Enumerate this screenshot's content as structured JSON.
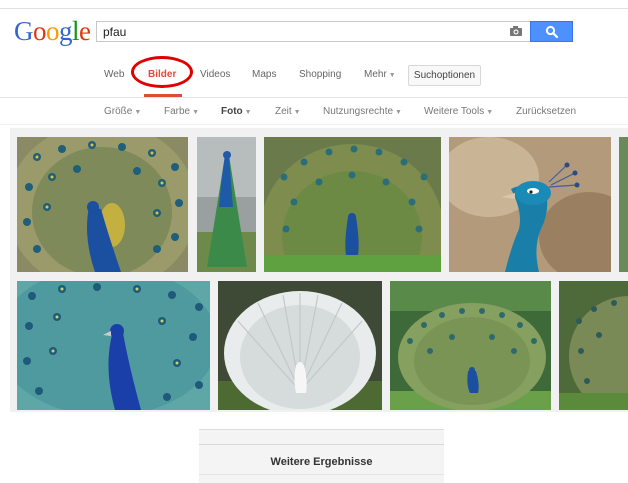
{
  "logo": {
    "letters": [
      "G",
      "o",
      "o",
      "g",
      "l",
      "e"
    ],
    "colors": [
      "#3366cc",
      "#dc3912",
      "#ff9900",
      "#3366cc",
      "#109618",
      "#dc3912"
    ]
  },
  "search": {
    "query": "pfau"
  },
  "nav": {
    "web": "Web",
    "bilder": "Bilder",
    "videos": "Videos",
    "maps": "Maps",
    "shopping": "Shopping",
    "mehr": "Mehr",
    "suchoptionen": "Suchoptionen"
  },
  "tools": {
    "groesse": "Größe",
    "farbe": "Farbe",
    "foto": "Foto",
    "zeit": "Zeit",
    "nutzungsrechte": "Nutzungsrechte",
    "weitere_tools": "Weitere Tools",
    "zuruecksetzen": "Zurücksetzen"
  },
  "more_results": "Weitere Ergebnisse",
  "colors": {
    "accent_red": "#dd4b39",
    "search_blue": "#4d90fe"
  }
}
